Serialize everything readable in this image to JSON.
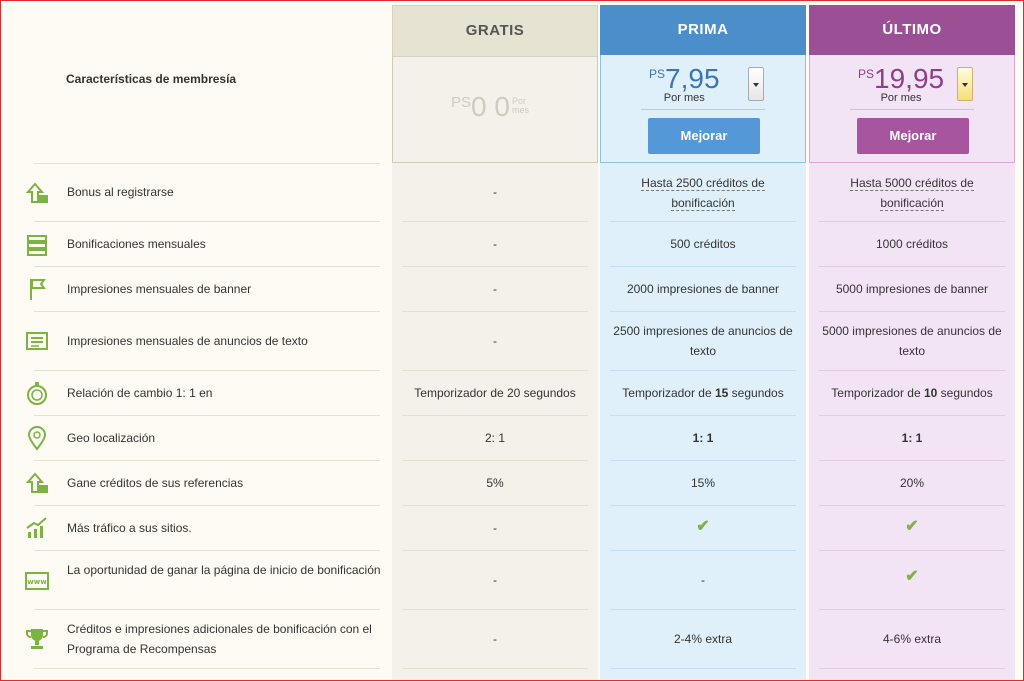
{
  "header": {
    "features_label": "Características de membresía",
    "plans": [
      {
        "name": "GRATIS",
        "currency": "PS",
        "price": "0 0",
        "period": "Por mes"
      },
      {
        "name": "PRIMA",
        "currency": "PS",
        "price": "7,95",
        "period": "Por mes",
        "button": "Mejorar"
      },
      {
        "name": "ÚLTIMO",
        "currency": "PS",
        "price": "19,95",
        "period": "Por mes",
        "button": "Mejorar"
      }
    ]
  },
  "colors": {
    "free": "#e6e3d2",
    "prima": "#4b8ec9",
    "ultimo": "#9b4f95",
    "check": "#7cb342",
    "icon": "#7cb342"
  },
  "rows": [
    {
      "icon": "upload-arrow-icon",
      "label": "Bonus al registrarse",
      "free": "-",
      "prima_a": "Hasta 2500 créditos de",
      "prima_b": "bonificación",
      "ult_a": "Hasta 5000 créditos de",
      "ult_b": "bonificación"
    },
    {
      "icon": "stack-icon",
      "label": "Bonificaciones mensuales",
      "free": "-",
      "prima": "500 créditos",
      "ult": "1000 créditos"
    },
    {
      "icon": "banner-flag-icon",
      "label": "Impresiones mensuales de banner",
      "free": "-",
      "prima": "2000 impresiones de banner",
      "ult": "5000 impresiones de banner"
    },
    {
      "icon": "text-list-icon",
      "label": "Impresiones mensuales de anuncios de texto",
      "free": "-",
      "prima": "2500 impresiones de anuncios de texto",
      "ult": "5000 impresiones de anuncios de texto"
    },
    {
      "icon": "stopwatch-icon",
      "label": "Relación de cambio 1: 1 en",
      "free": "Temporizador de 20 segundos",
      "prima_pre": "Temporizador de ",
      "prima_bold": "15",
      "prima_post": " segundos",
      "ult_pre": "Temporizador de ",
      "ult_bold": "10",
      "ult_post": " segundos"
    },
    {
      "icon": "location-pin-icon",
      "label": "Geo localización",
      "free": "2: 1",
      "prima": "1: 1",
      "ult": "1: 1"
    },
    {
      "icon": "upload-arrow-icon",
      "label": "Gane créditos de sus referencias",
      "free": "5%",
      "prima": "15%",
      "ult": "20%"
    },
    {
      "icon": "growth-chart-icon",
      "label": "Más tráfico a sus sitios.",
      "free": "-",
      "prima": "✔",
      "ult": "✔"
    },
    {
      "icon": "www-browser-icon",
      "label": "La oportunidad de ganar la página de inicio de bonificación",
      "free": "-",
      "prima": "-",
      "ult": "✔"
    },
    {
      "icon": "trophy-icon",
      "label": "Créditos e impresiones adicionales de bonificación con el Programa de Recompensas",
      "free": "-",
      "prima": "2-4% extra",
      "ult": "4-6% extra"
    }
  ]
}
